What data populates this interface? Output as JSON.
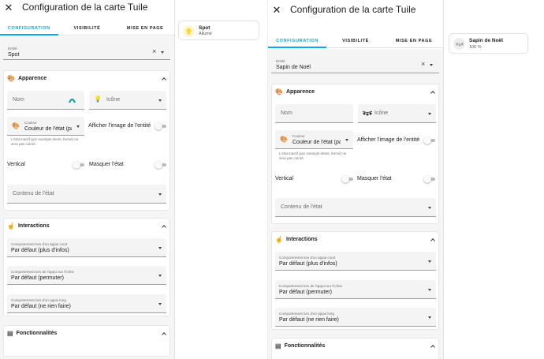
{
  "left": {
    "dialog_title": "Configuration de la carte Tuile",
    "tabs": [
      "CONFIGURATION",
      "VISIBILITÉ",
      "MISE EN PAGE"
    ],
    "entity": {
      "label": "Entité",
      "value": "Spot"
    },
    "appearance": {
      "title": "Apparence",
      "name_placeholder": "Nom",
      "icon_placeholder": "Icône",
      "color": {
        "label": "Couleur",
        "value": "Couleur de l'état (par",
        "helper": "L'état inactif (par exemple éteint, fermé) ne sera pas coloré."
      },
      "show_entity_picture": "Afficher l'image de l'entité",
      "vertical": "Vertical",
      "hide_state": "Masquer l'état",
      "state_content_placeholder": "Contenu de l'état"
    },
    "interactions": {
      "title": "Interactions",
      "tap": {
        "label": "Comportement lors d'un appui court",
        "value": "Par défaut (plus d'infos)"
      },
      "icon_tap": {
        "label": "Comportement lors de l'appui sur l'icône",
        "value": "Par défaut (permuter)"
      },
      "hold": {
        "label": "Comportement lors d'un appui long",
        "value": "Par défaut (ne rien faire)"
      }
    },
    "features": {
      "title": "Fonctionnalités"
    },
    "preview": {
      "name": "Spot",
      "state": "Allumé"
    }
  },
  "right": {
    "dialog_title": "Configuration de la carte Tuile",
    "tabs": [
      "CONFIGURATION",
      "VISIBILITÉ",
      "MISE EN PAGE"
    ],
    "entity": {
      "label": "Entité",
      "value": "Sapin de Noël"
    },
    "appearance": {
      "title": "Apparence",
      "name_placeholder": "Nom",
      "icon_placeholder": "Icône",
      "color": {
        "label": "Couleur",
        "value": "Couleur de l'état (par",
        "helper": "L'état inactif (par exemple éteint, fermé) ne sera pas coloré."
      },
      "show_entity_picture": "Afficher l'image de l'entité",
      "vertical": "Vertical",
      "hide_state": "Masquer l'état",
      "state_content_placeholder": "Contenu de l'état"
    },
    "interactions": {
      "title": "Interactions",
      "tap": {
        "label": "Comportement lors d'un appui court",
        "value": "Par défaut (plus d'infos)"
      },
      "icon_tap": {
        "label": "Comportement lors de l'appui sur l'icône",
        "value": "Par défaut (permuter)"
      },
      "hold": {
        "label": "Comportement lors d'un appui long",
        "value": "Par défaut (ne rien faire)"
      }
    },
    "features": {
      "title": "Fonctionnalités"
    },
    "preview": {
      "name": "Sapin de Noël",
      "state": "100 %"
    }
  },
  "colors": {
    "accent": "#03a9f4",
    "lamp_on": "#fdd835",
    "lamp_bg": "#fff6d5"
  }
}
